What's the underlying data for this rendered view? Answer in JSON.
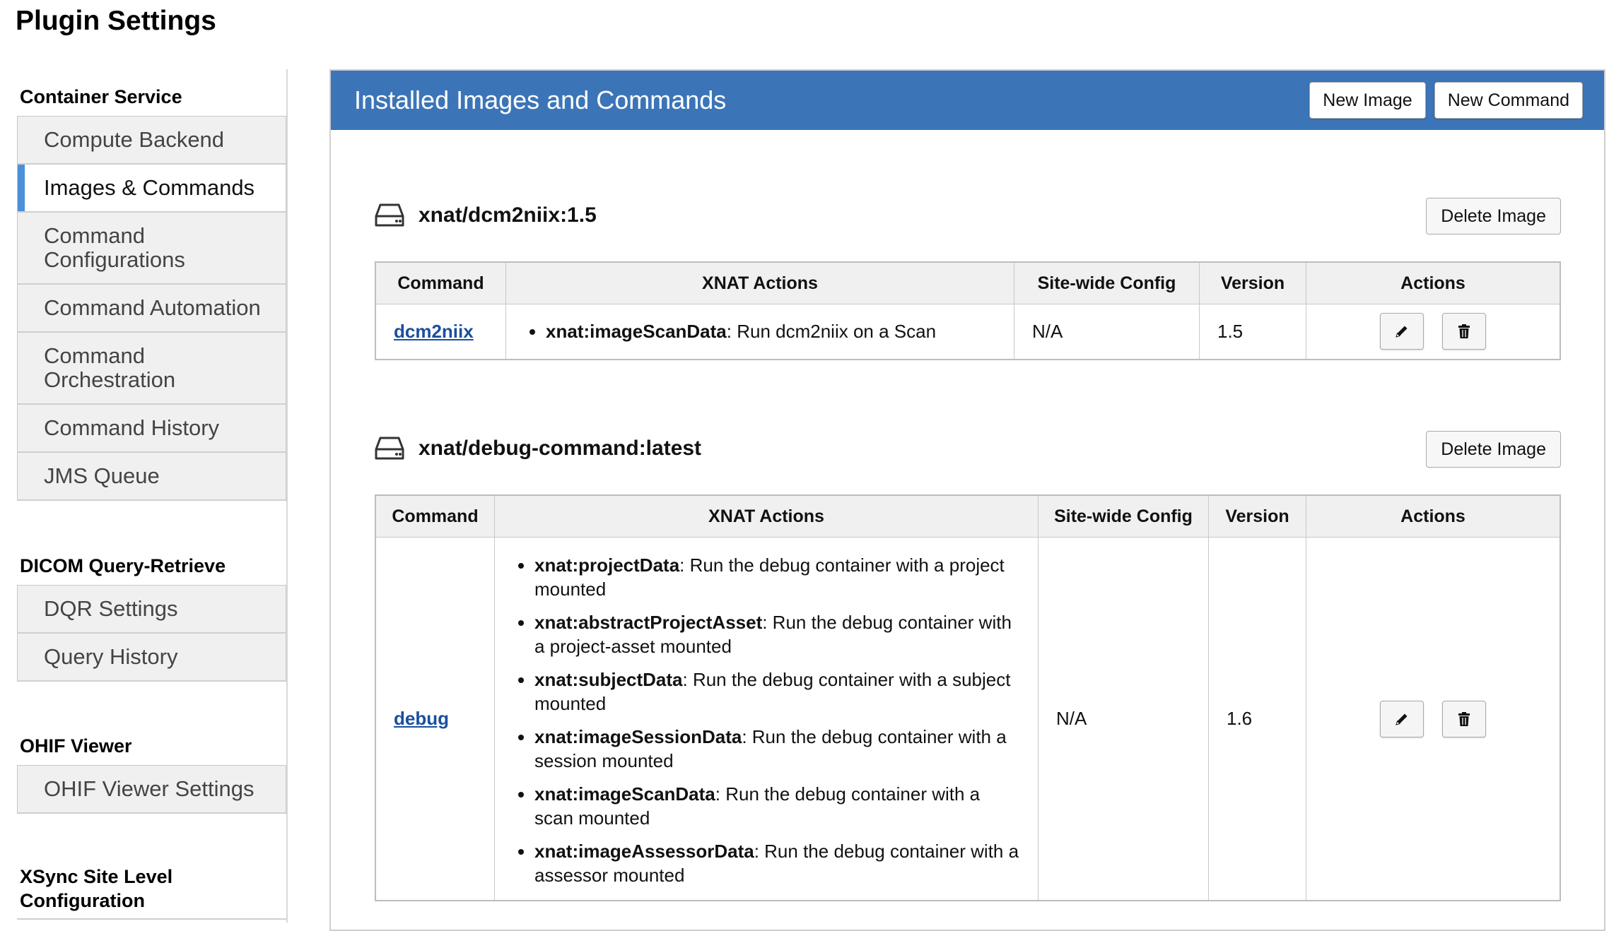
{
  "page": {
    "title": "Plugin Settings"
  },
  "sidebar": {
    "groups": [
      {
        "heading": "Container Service",
        "items": [
          {
            "label": "Compute Backend",
            "active": false
          },
          {
            "label": "Images & Commands",
            "active": true
          },
          {
            "label": "Command Configurations",
            "active": false
          },
          {
            "label": "Command Automation",
            "active": false
          },
          {
            "label": "Command Orchestration",
            "active": false
          },
          {
            "label": "Command History",
            "active": false
          },
          {
            "label": "JMS Queue",
            "active": false
          }
        ]
      },
      {
        "heading": "DICOM Query-Retrieve",
        "items": [
          {
            "label": "DQR Settings",
            "active": false
          },
          {
            "label": "Query History",
            "active": false
          }
        ]
      },
      {
        "heading": "OHIF Viewer",
        "items": [
          {
            "label": "OHIF Viewer Settings",
            "active": false
          }
        ]
      },
      {
        "heading": "XSync Site Level Configuration",
        "items": []
      }
    ]
  },
  "panel": {
    "title": "Installed Images and Commands",
    "new_image_label": "New Image",
    "new_command_label": "New Command",
    "header_color": "#3b75b8"
  },
  "table_headers": {
    "command": "Command",
    "xnat_actions": "XNAT Actions",
    "site_wide_config": "Site-wide Config",
    "version": "Version",
    "actions": "Actions"
  },
  "images": [
    {
      "name": "xnat/dcm2niix:1.5",
      "delete_label": "Delete Image",
      "commands": [
        {
          "command": "dcm2niix",
          "xnat_actions": [
            {
              "name": "xnat:imageScanData",
              "desc": ": Run dcm2niix on a Scan"
            }
          ],
          "site_wide_config": "N/A",
          "version": "1.5"
        }
      ]
    },
    {
      "name": "xnat/debug-command:latest",
      "delete_label": "Delete Image",
      "commands": [
        {
          "command": "debug",
          "xnat_actions": [
            {
              "name": "xnat:projectData",
              "desc": ": Run the debug container with a project mounted"
            },
            {
              "name": "xnat:abstractProjectAsset",
              "desc": ": Run the debug container with a project-asset mounted"
            },
            {
              "name": "xnat:subjectData",
              "desc": ": Run the debug container with a subject mounted"
            },
            {
              "name": "xnat:imageSessionData",
              "desc": ": Run the debug container with a session mounted"
            },
            {
              "name": "xnat:imageScanData",
              "desc": ": Run the debug container with a scan mounted"
            },
            {
              "name": "xnat:imageAssessorData",
              "desc": ": Run the debug container with a assessor mounted"
            }
          ],
          "site_wide_config": "N/A",
          "version": "1.6"
        }
      ]
    }
  ],
  "icons": {
    "image": "hard-drive-icon",
    "edit": "pencil-icon",
    "delete": "trash-icon",
    "active_marker_color": "#4a90d9"
  }
}
